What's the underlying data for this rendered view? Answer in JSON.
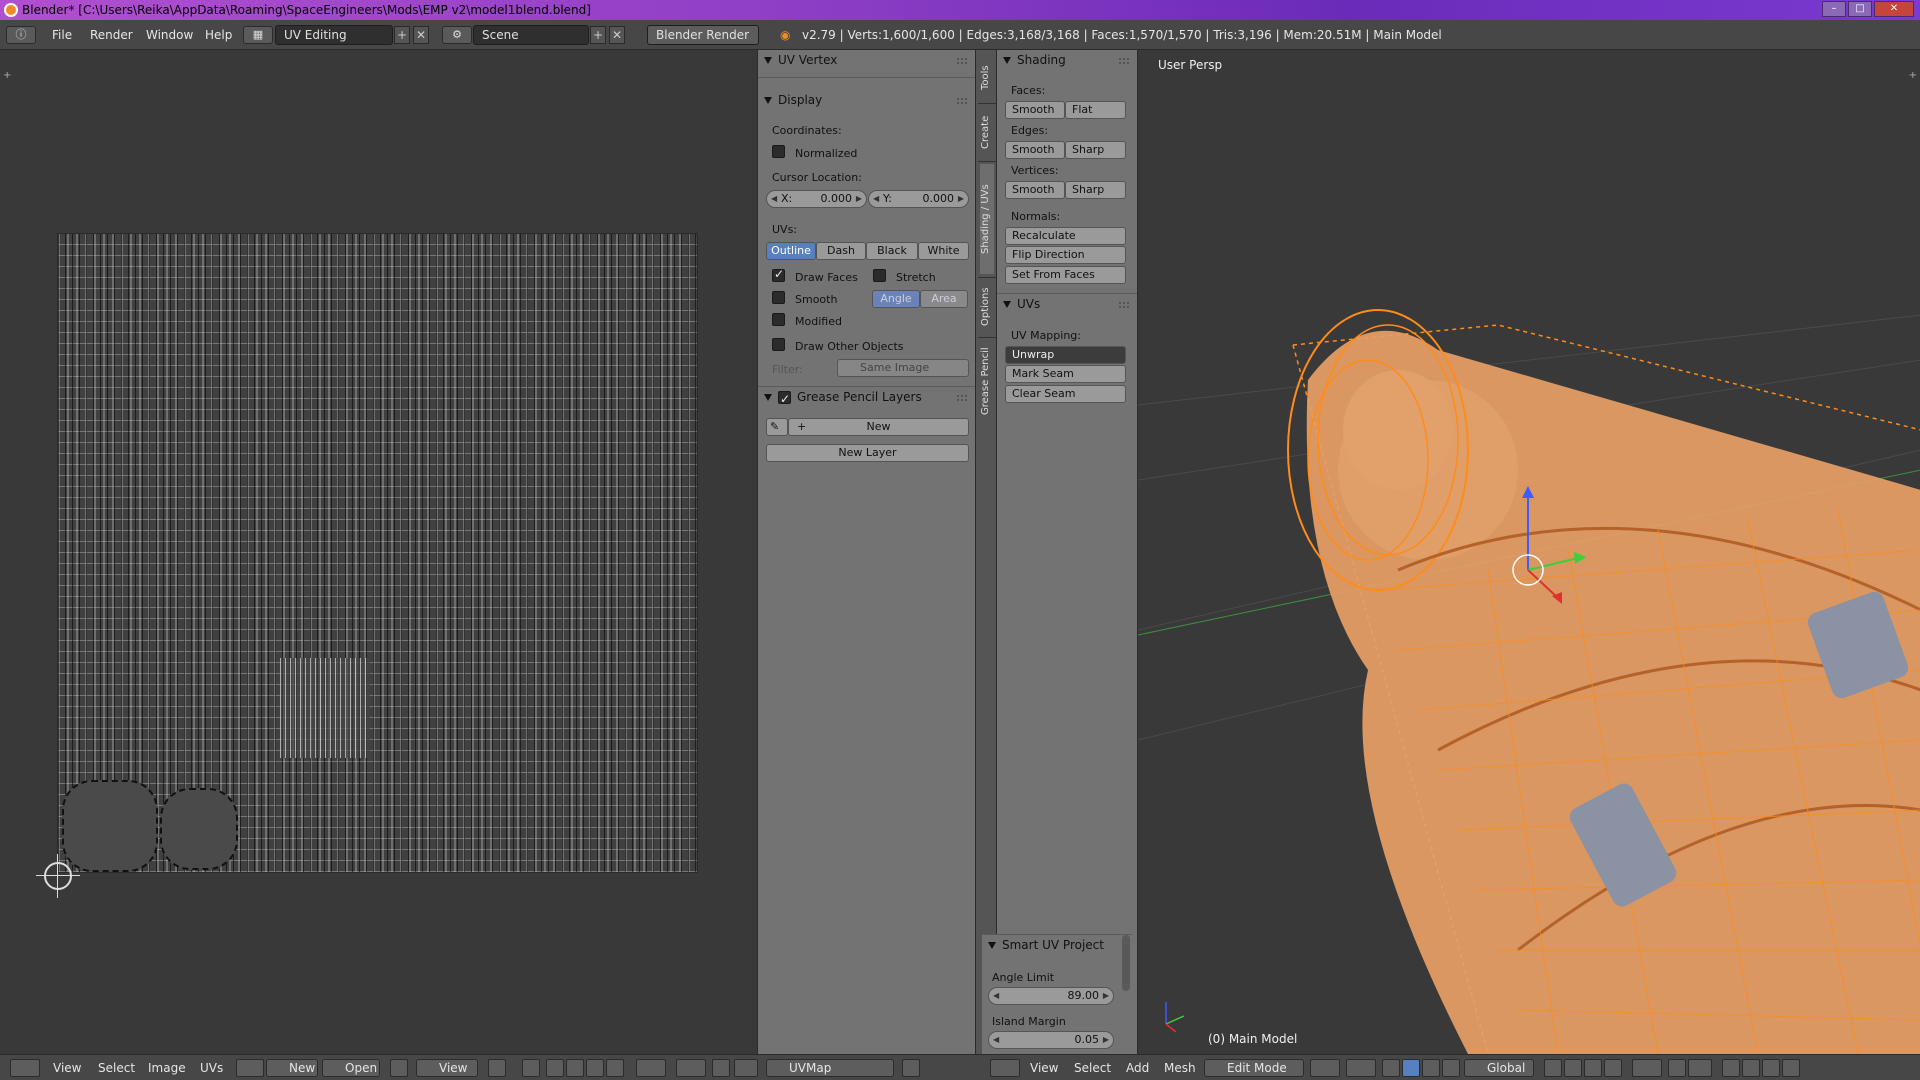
{
  "window": {
    "title": "Blender* [C:\\Users\\Reika\\AppData\\Roaming\\SpaceEngineers\\Mods\\EMP v2\\model1blend.blend]"
  },
  "infobar": {
    "menus": [
      "File",
      "Render",
      "Window",
      "Help"
    ],
    "screen_layout": "UV Editing",
    "scene": "Scene",
    "render_engine": "Blender Render",
    "stats": "v2.79 | Verts:1,600/1,600 | Edges:3,168/3,168 | Faces:1,570/1,570 | Tris:3,196 | Mem:20.51M | Main Model"
  },
  "uv_panel": {
    "uv_vertex_title": "UV Vertex",
    "display_title": "Display",
    "coordinates_label": "Coordinates:",
    "normalized_label": "Normalized",
    "cursor_location_label": "Cursor Location:",
    "cursor_x_key": "X:",
    "cursor_x": "0.000",
    "cursor_y_key": "Y:",
    "cursor_y": "0.000",
    "uvs_label": "UVs:",
    "uv_styles": [
      "Outline",
      "Dash",
      "Black",
      "White"
    ],
    "draw_faces": "Draw Faces",
    "stretch": "Stretch",
    "smooth": "Smooth",
    "angle": "Angle",
    "area": "Area",
    "modified": "Modified",
    "draw_other_objects": "Draw Other Objects",
    "filter_label": "Filter:",
    "filter_value": "Same Image",
    "grease_pencil_title": "Grease Pencil Layers",
    "gp_new": "New",
    "gp_new_layer": "New Layer"
  },
  "vtabs": [
    "Tools",
    "Create",
    "Shading / UVs",
    "Options",
    "Grease Pencil"
  ],
  "tool_panel": {
    "shading_title": "Shading",
    "faces_label": "Faces:",
    "faces_buttons": [
      "Smooth",
      "Flat"
    ],
    "edges_label": "Edges:",
    "edges_buttons": [
      "Smooth",
      "Sharp"
    ],
    "vertices_label": "Vertices:",
    "vertices_buttons": [
      "Smooth",
      "Sharp"
    ],
    "normals_label": "Normals:",
    "normals_buttons": [
      "Recalculate",
      "Flip Direction",
      "Set From Faces"
    ],
    "uvs_title": "UVs",
    "uv_mapping_label": "UV Mapping:",
    "uv_mapping_value": "Unwrap",
    "mark_seam": "Mark Seam",
    "clear_seam": "Clear Seam",
    "smart_uv_title": "Smart UV Project",
    "angle_limit_label": "Angle Limit",
    "angle_limit_value": "89.00",
    "island_margin_label": "Island Margin",
    "island_margin_value": "0.05"
  },
  "viewport": {
    "view_label": "User Persp",
    "object_label": "(0) Main Model"
  },
  "footer": {
    "uv_menus": [
      "View",
      "Select",
      "Image",
      "UVs"
    ],
    "new_label": "New",
    "open_label": "Open",
    "view_label": "View",
    "uvmap_label": "UVMap",
    "vp_menus": [
      "View",
      "Select",
      "Add",
      "Mesh"
    ],
    "mode": "Edit Mode",
    "orientation": "Global"
  },
  "colors": {
    "accent_blue": "#5680c2",
    "selection_orange": "#ff8c1a",
    "title_gradient": "#8f3fc6"
  }
}
